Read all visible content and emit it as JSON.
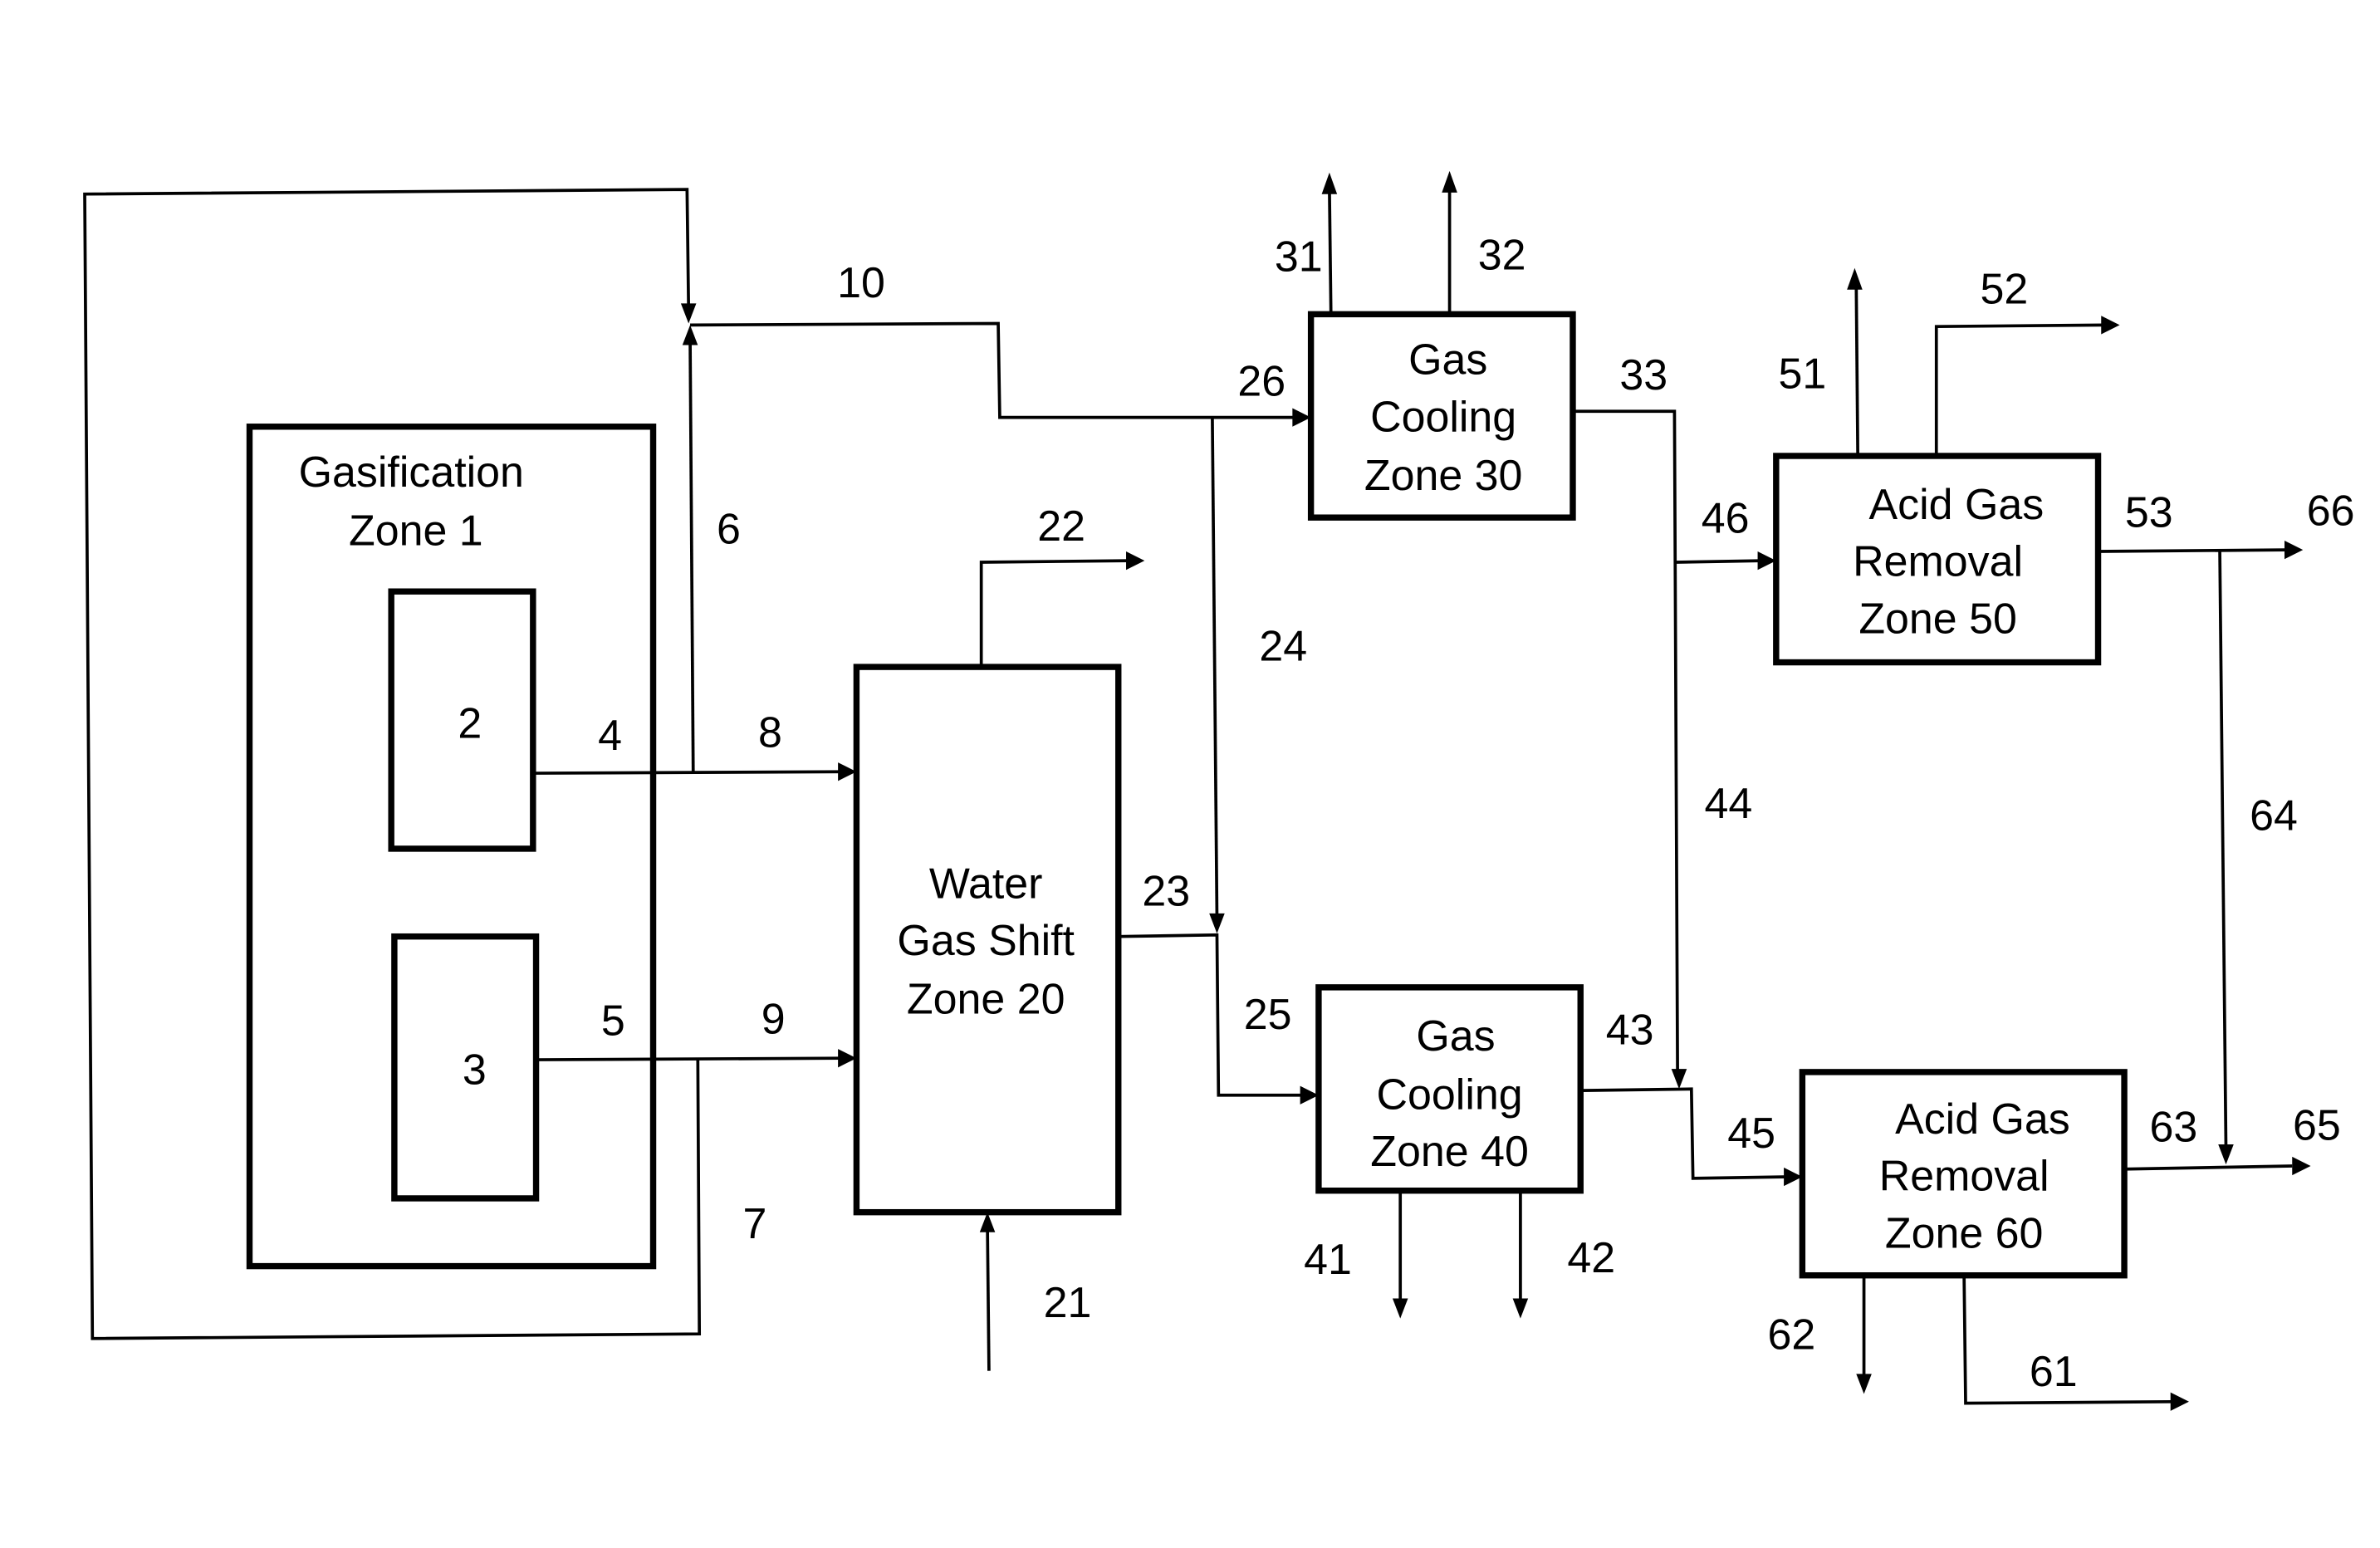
{
  "figure": {
    "type": "process-flow-diagram",
    "colors": {
      "line": "#000000",
      "background": "#ffffff"
    }
  },
  "units": [
    {
      "id": "gasification-zone-1",
      "lines": [
        "Gasification",
        "Zone 1"
      ]
    },
    {
      "id": "gasifier-2",
      "lines": [
        "2"
      ]
    },
    {
      "id": "gasifier-3",
      "lines": [
        "3"
      ]
    },
    {
      "id": "water-gas-shift-zone-20",
      "lines": [
        "Water",
        "Gas Shift",
        "Zone 20"
      ]
    },
    {
      "id": "gas-cooling-zone-30",
      "lines": [
        "Gas",
        "Cooling",
        "Zone 30"
      ]
    },
    {
      "id": "gas-cooling-zone-40",
      "lines": [
        "Gas",
        "Cooling",
        "Zone 40"
      ]
    },
    {
      "id": "acid-gas-removal-zone-50",
      "lines": [
        "Acid Gas",
        "Removal",
        "Zone 50"
      ]
    },
    {
      "id": "acid-gas-removal-zone-60",
      "lines": [
        "Acid Gas",
        "Removal",
        "Zone 60"
      ]
    }
  ],
  "streams": {
    "s4": "4",
    "s5": "5",
    "s6": "6",
    "s7": "7",
    "s8": "8",
    "s9": "9",
    "s10": "10",
    "s21": "21",
    "s22": "22",
    "s23": "23",
    "s24": "24",
    "s25": "25",
    "s26": "26",
    "s31": "31",
    "s32": "32",
    "s33": "33",
    "s41": "41",
    "s42": "42",
    "s43": "43",
    "s44": "44",
    "s45": "45",
    "s46": "46",
    "s51": "51",
    "s52": "52",
    "s53": "53",
    "s61": "61",
    "s62": "62",
    "s63": "63",
    "s64": "64",
    "s65": "65",
    "s66": "66"
  },
  "connections": [
    {
      "stream": "4",
      "from": "gasifier-2",
      "to": "junction-4-8"
    },
    {
      "stream": "8",
      "from": "junction-4-8",
      "to": "water-gas-shift-zone-20"
    },
    {
      "stream": "6",
      "from": "junction-4-8",
      "to": "junction-10"
    },
    {
      "stream": "5",
      "from": "gasifier-3",
      "to": "junction-5-9"
    },
    {
      "stream": "9",
      "from": "junction-5-9",
      "to": "water-gas-shift-zone-20"
    },
    {
      "stream": "7",
      "from": "junction-5-9",
      "to": "junction-10"
    },
    {
      "stream": "10",
      "from": "junction-10",
      "to": "junction-26-24"
    },
    {
      "stream": "26",
      "from": "junction-26-24",
      "to": "gas-cooling-zone-30"
    },
    {
      "stream": "24",
      "from": "junction-26-24",
      "to": "junction-23-25"
    },
    {
      "stream": "21",
      "from": "external",
      "to": "water-gas-shift-zone-20"
    },
    {
      "stream": "22",
      "from": "water-gas-shift-zone-20",
      "to": "external"
    },
    {
      "stream": "23",
      "from": "water-gas-shift-zone-20",
      "to": "junction-23-25"
    },
    {
      "stream": "25",
      "from": "junction-23-25",
      "to": "gas-cooling-zone-40"
    },
    {
      "stream": "31",
      "from": "gas-cooling-zone-30",
      "to": "external"
    },
    {
      "stream": "32",
      "from": "gas-cooling-zone-30",
      "to": "external"
    },
    {
      "stream": "33",
      "from": "gas-cooling-zone-30",
      "to": "junction-46-44"
    },
    {
      "stream": "46",
      "from": "junction-46-44",
      "to": "acid-gas-removal-zone-50"
    },
    {
      "stream": "44",
      "from": "junction-46-44",
      "to": "junction-43-45"
    },
    {
      "stream": "41",
      "from": "gas-cooling-zone-40",
      "to": "external"
    },
    {
      "stream": "42",
      "from": "gas-cooling-zone-40",
      "to": "external"
    },
    {
      "stream": "43",
      "from": "gas-cooling-zone-40",
      "to": "junction-43-45"
    },
    {
      "stream": "45",
      "from": "junction-43-45",
      "to": "acid-gas-removal-zone-60"
    },
    {
      "stream": "51",
      "from": "acid-gas-removal-zone-50",
      "to": "external"
    },
    {
      "stream": "52",
      "from": "acid-gas-removal-zone-50",
      "to": "external"
    },
    {
      "stream": "53",
      "from": "acid-gas-removal-zone-50",
      "to": "junction-53-66"
    },
    {
      "stream": "66",
      "from": "junction-53-66",
      "to": "external"
    },
    {
      "stream": "64",
      "from": "junction-53-66",
      "to": "junction-63-65"
    },
    {
      "stream": "61",
      "from": "acid-gas-removal-zone-60",
      "to": "external"
    },
    {
      "stream": "62",
      "from": "acid-gas-removal-zone-60",
      "to": "external"
    },
    {
      "stream": "63",
      "from": "acid-gas-removal-zone-60",
      "to": "junction-63-65"
    },
    {
      "stream": "65",
      "from": "junction-63-65",
      "to": "external"
    }
  ]
}
